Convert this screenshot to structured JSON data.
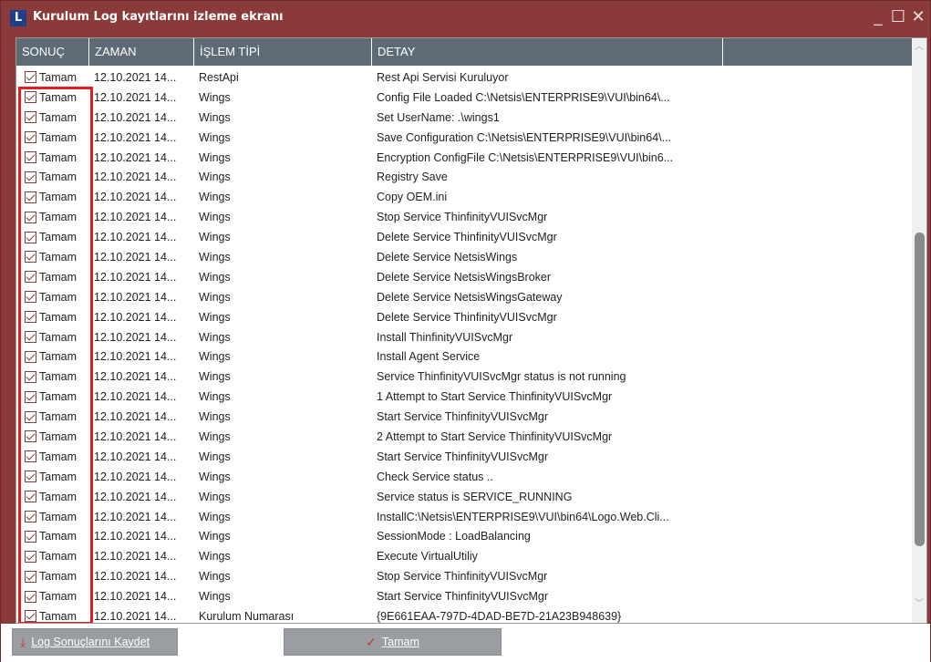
{
  "window": {
    "title": "Kurulum Log kayıtlarını izleme ekranı",
    "logo_letter": "L",
    "min_glyph": "_",
    "max_glyph": "☐",
    "close_glyph": "✕"
  },
  "columns": [
    "SONUÇ",
    "ZAMAN",
    "İŞLEM TİPİ",
    "DETAY",
    ""
  ],
  "rows": [
    {
      "result": "Tamam",
      "time": "12.10.2021 14...",
      "type": "RestApi",
      "detail": "Rest Api Servisi Kuruluyor"
    },
    {
      "result": "Tamam",
      "time": "12.10.2021 14...",
      "type": "Wings",
      "detail": "Config File Loaded C:\\Netsis\\ENTERPRISE9\\VUI\\bin64\\..."
    },
    {
      "result": "Tamam",
      "time": "12.10.2021 14...",
      "type": "Wings",
      "detail": "Set UserName: .\\wings1"
    },
    {
      "result": "Tamam",
      "time": "12.10.2021 14...",
      "type": "Wings",
      "detail": "Save Configuration C:\\Netsis\\ENTERPRISE9\\VUI\\bin64\\..."
    },
    {
      "result": "Tamam",
      "time": "12.10.2021 14...",
      "type": "Wings",
      "detail": "Encryption ConfigFile C:\\Netsis\\ENTERPRISE9\\VUI\\bin6..."
    },
    {
      "result": "Tamam",
      "time": "12.10.2021 14...",
      "type": "Wings",
      "detail": "Registry Save"
    },
    {
      "result": "Tamam",
      "time": "12.10.2021 14...",
      "type": "Wings",
      "detail": "Copy OEM.ini"
    },
    {
      "result": "Tamam",
      "time": "12.10.2021 14...",
      "type": "Wings",
      "detail": "Stop Service ThinfinityVUISvcMgr"
    },
    {
      "result": "Tamam",
      "time": "12.10.2021 14...",
      "type": "Wings",
      "detail": "Delete Service ThinfinityVUISvcMgr"
    },
    {
      "result": "Tamam",
      "time": "12.10.2021 14...",
      "type": "Wings",
      "detail": "Delete Service NetsisWings"
    },
    {
      "result": "Tamam",
      "time": "12.10.2021 14...",
      "type": "Wings",
      "detail": "Delete Service NetsisWingsBroker"
    },
    {
      "result": "Tamam",
      "time": "12.10.2021 14...",
      "type": "Wings",
      "detail": "Delete Service NetsisWingsGateway"
    },
    {
      "result": "Tamam",
      "time": "12.10.2021 14...",
      "type": "Wings",
      "detail": "Delete Service ThinfinityVUISvcMgr"
    },
    {
      "result": "Tamam",
      "time": "12.10.2021 14...",
      "type": "Wings",
      "detail": "Install ThinfinityVUISvcMgr"
    },
    {
      "result": "Tamam",
      "time": "12.10.2021 14...",
      "type": "Wings",
      "detail": "Install Agent Service"
    },
    {
      "result": "Tamam",
      "time": "12.10.2021 14...",
      "type": "Wings",
      "detail": "Service ThinfinityVUISvcMgr status is not running"
    },
    {
      "result": "Tamam",
      "time": "12.10.2021 14...",
      "type": "Wings",
      "detail": "1 Attempt to Start Service ThinfinityVUISvcMgr"
    },
    {
      "result": "Tamam",
      "time": "12.10.2021 14...",
      "type": "Wings",
      "detail": "Start Service ThinfinityVUISvcMgr"
    },
    {
      "result": "Tamam",
      "time": "12.10.2021 14...",
      "type": "Wings",
      "detail": "2 Attempt to Start Service ThinfinityVUISvcMgr"
    },
    {
      "result": "Tamam",
      "time": "12.10.2021 14...",
      "type": "Wings",
      "detail": "Start Service ThinfinityVUISvcMgr"
    },
    {
      "result": "Tamam",
      "time": "12.10.2021 14...",
      "type": "Wings",
      "detail": "Check Service status .."
    },
    {
      "result": "Tamam",
      "time": "12.10.2021 14...",
      "type": "Wings",
      "detail": "Service status is  SERVICE_RUNNING"
    },
    {
      "result": "Tamam",
      "time": "12.10.2021 14...",
      "type": "Wings",
      "detail": "InstallC:\\Netsis\\ENTERPRISE9\\VUI\\bin64\\Logo.Web.Cli..."
    },
    {
      "result": "Tamam",
      "time": "12.10.2021 14...",
      "type": "Wings",
      "detail": "SessionMode : LoadBalancing"
    },
    {
      "result": "Tamam",
      "time": "12.10.2021 14...",
      "type": "Wings",
      "detail": "Execute VirtualUtiliy"
    },
    {
      "result": "Tamam",
      "time": "12.10.2021 14...",
      "type": "Wings",
      "detail": "Stop Service ThinfinityVUISvcMgr"
    },
    {
      "result": "Tamam",
      "time": "12.10.2021 14...",
      "type": "Wings",
      "detail": "Start Service ThinfinityVUISvcMgr"
    },
    {
      "result": "Tamam",
      "time": "12.10.2021 14...",
      "type": "Kurulum Numarası",
      "detail": "{9E661EAA-797D-4DAD-BE7D-21A23B948639}"
    }
  ],
  "buttons": {
    "save_log": "Log Sonuçlarını Kaydet",
    "ok": "Tamam"
  },
  "colors": {
    "titlebar": "#8b3a3a",
    "header": "#5e6b75",
    "highlight": "#e11d1d",
    "button": "#9a9ea2"
  },
  "icons": {
    "save": "download-icon",
    "ok": "check-circle-icon",
    "row": "checkbox-checked-icon"
  }
}
